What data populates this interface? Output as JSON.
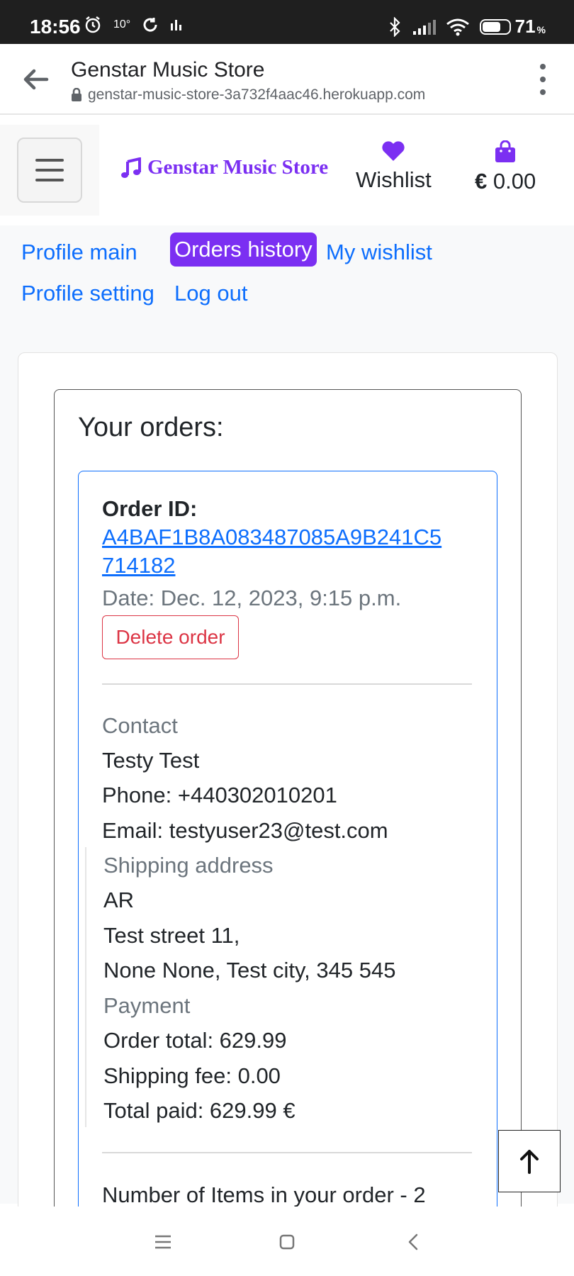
{
  "status_bar": {
    "time": "18:56",
    "temperature": "10°",
    "battery_percent": "71",
    "battery_symbol": "%",
    "battery_level": 0.71
  },
  "browser": {
    "page_title": "Genstar Music Store",
    "url": "genstar-music-store-3a732f4aac46.herokuapp.com"
  },
  "header": {
    "brand": "Genstar Music Store",
    "wishlist_label": "Wishlist",
    "bag_currency": "€",
    "bag_amount": "0.00",
    "accent_color": "#7b2ff2"
  },
  "profile_nav": {
    "items": [
      {
        "label": "Profile main",
        "active": false
      },
      {
        "label": "Orders history",
        "active": true
      },
      {
        "label": "My wishlist",
        "active": false
      },
      {
        "label": "Profile setting",
        "active": false
      },
      {
        "label": "Log out",
        "active": false
      }
    ]
  },
  "orders": {
    "heading": "Your orders:",
    "order": {
      "id_label": "Order ID:",
      "id_line1": "A4BAF1B8A083487085A9B241C5",
      "id_line2": "714182",
      "date": "Date: Dec. 12, 2023, 9:15 p.m.",
      "delete_label": "Delete order",
      "contact_heading": "Contact",
      "contact_name": "Testy Test",
      "phone": "Phone: +440302010201",
      "email": "Email: testyuser23@test.com",
      "shipping_heading": "Shipping address",
      "country": "AR",
      "street": "Test street 11,",
      "city_line": "None None, Test city, 345 545",
      "payment_heading": "Payment",
      "order_total": "Order total: 629.99",
      "shipping_fee": "Shipping fee: 0.00",
      "total_paid": "Total paid: 629.99 €",
      "items_count": "Number of Items in your order - 2"
    }
  }
}
